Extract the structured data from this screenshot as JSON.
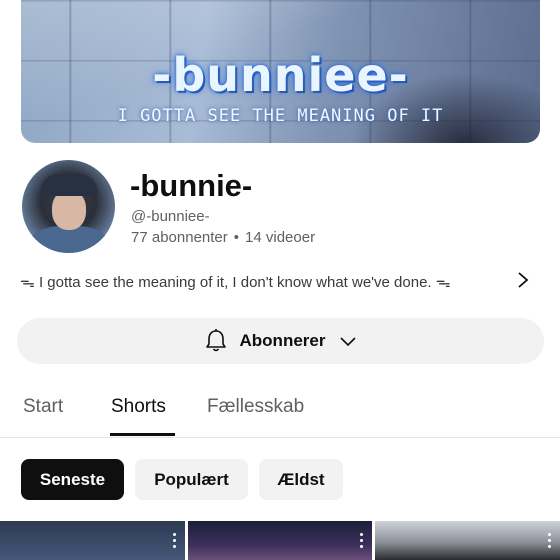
{
  "banner": {
    "title": "-bunniee-",
    "subtitle": "I GOTTA SEE THE MEANING OF IT"
  },
  "channel": {
    "name": "-bunnie-",
    "handle": "@-bunniee-",
    "subscribers": "77 abonnenter",
    "separator": "•",
    "videos": "14 videoer",
    "description": "ᯓ I gotta see the meaning of it, I don't know what we've done. ᯓ"
  },
  "subscribe_button": {
    "label": "Abonnerer",
    "icons": [
      "bell-icon",
      "chevron-down-icon"
    ]
  },
  "tabs": [
    {
      "label": "Start",
      "active": false
    },
    {
      "label": "Shorts",
      "active": true
    },
    {
      "label": "Fællesskab",
      "active": false
    }
  ],
  "filters": [
    {
      "label": "Seneste",
      "selected": true
    },
    {
      "label": "Populært",
      "selected": false
    },
    {
      "label": "Ældst",
      "selected": false
    }
  ],
  "colors": {
    "text_primary": "#0f0f0f",
    "text_secondary": "#606060",
    "chip_bg": "#f2f2f2",
    "chip_selected_bg": "#0f0f0f"
  }
}
